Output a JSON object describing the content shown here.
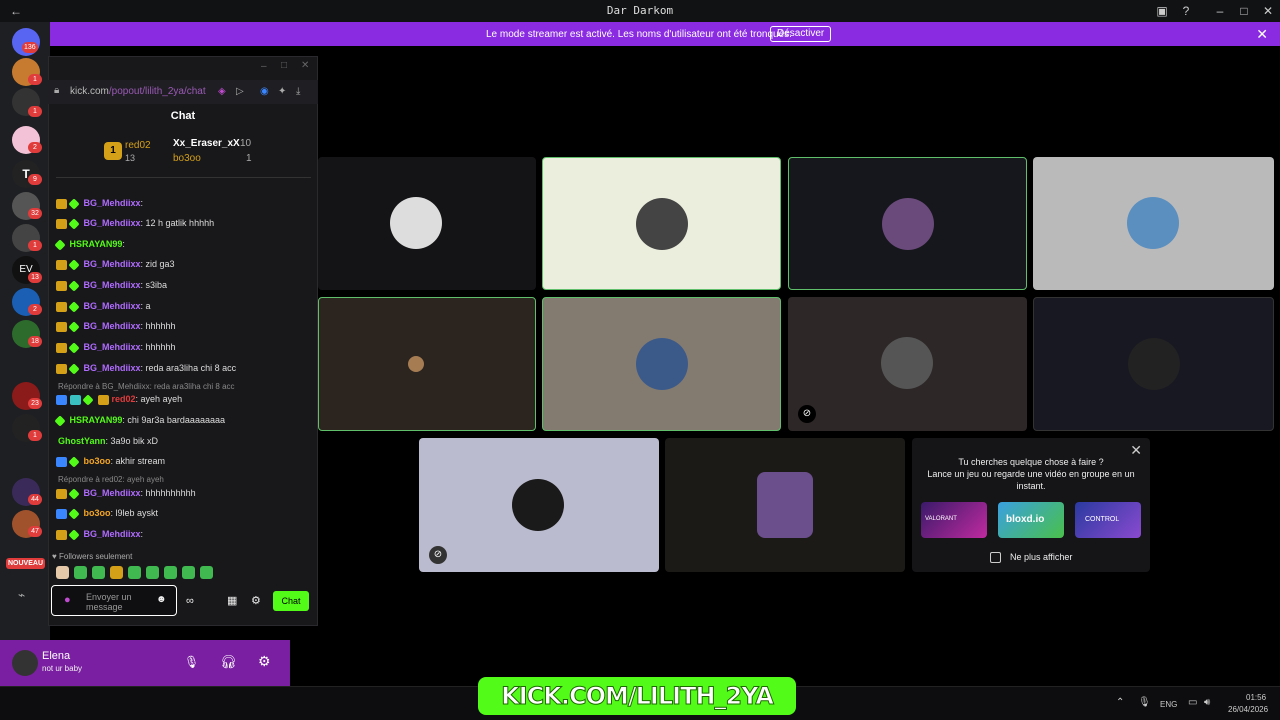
{
  "window": {
    "title": "Dar Darkom"
  },
  "banner": {
    "message": "Le mode streamer est activé. Les noms d'utilisateur ont été tronqués.",
    "button": "Désactiver"
  },
  "servers": [
    {
      "badge": "136"
    },
    {
      "badge": "1"
    },
    {
      "badge": "1"
    },
    {
      "badge": "2"
    },
    {
      "badge": "9"
    },
    {
      "badge": "32"
    },
    {
      "badge": "1"
    },
    {
      "badge": "13"
    },
    {
      "badge": "2"
    },
    {
      "badge": "18"
    },
    {
      "badge": "23"
    },
    {
      "badge": "1"
    },
    {
      "badge": "44"
    },
    {
      "badge": "47"
    }
  ],
  "new_label": "NOUVEAU",
  "chat": {
    "url_host": "kick.com",
    "url_path": "/popout/lilith_2ya/chat",
    "title": "Chat",
    "leaderboard": {
      "first": {
        "rank": "1",
        "name": "red02",
        "count": "13"
      },
      "second": {
        "name": "Xx_Eraser_xX",
        "count": "10"
      },
      "third": {
        "name": "bo3oo",
        "count": "1"
      }
    },
    "messages": [
      {
        "user": "BG_Mehdiixx",
        "text": ":",
        "color": "#b06bff"
      },
      {
        "user": "BG_Mehdiixx",
        "text": ": 12 h gatlik hhhhh",
        "color": "#b06bff"
      },
      {
        "user": "HSRAYAN99",
        "text": ":",
        "color": "#53fc18"
      },
      {
        "user": "BG_Mehdiixx",
        "text": ": zid ga3",
        "color": "#b06bff"
      },
      {
        "user": "BG_Mehdiixx",
        "text": ": s3iba",
        "color": "#b06bff"
      },
      {
        "user": "BG_Mehdiixx",
        "text": ": a",
        "color": "#b06bff"
      },
      {
        "user": "BG_Mehdiixx",
        "text": ": hhhhhh",
        "color": "#b06bff"
      },
      {
        "user": "BG_Mehdiixx",
        "text": ": hhhhhh",
        "color": "#b06bff"
      },
      {
        "user": "BG_Mehdiixx",
        "text": ": reda ara3liha chi 8 acc",
        "color": "#b06bff"
      },
      {
        "user": "red02",
        "text": ": ayeh ayeh",
        "color": "#e03c3c"
      },
      {
        "user": "HSRAYAN99",
        "text": ": chi 9ar3a bardaaaaaaaa",
        "color": "#53fc18"
      },
      {
        "user": "GhostYann",
        "text": ": 3a9o bik xD",
        "color": "#53fc18"
      },
      {
        "user": "bo3oo",
        "text": ": akhir stream",
        "color": "#f5a623"
      },
      {
        "user": "BG_Mehdiixx",
        "text": ": hhhhhhhhhh",
        "color": "#b06bff"
      },
      {
        "user": "bo3oo",
        "text": ": l9leb ayskt",
        "color": "#f5a623"
      },
      {
        "user": "BG_Mehdiixx",
        "text": ":",
        "color": "#b06bff"
      }
    ],
    "reply1": "Répondre à BG_Mehdiixx: reda ara3liha chi 8 acc",
    "reply2": "Répondre à red02: ayeh ayeh",
    "followers": "Followers seulement",
    "input_placeholder": "Envoyer un message",
    "send": "Chat"
  },
  "user": {
    "name": "Elena",
    "status": "not ur baby"
  },
  "promo": {
    "line1": "Tu cherches quelque chose à faire ?",
    "line2": "Lance un jeu ou regarde une vidéo en groupe en un instant.",
    "checkbox": "Ne plus afficher",
    "games": [
      "VALORANT",
      "bloxd.io",
      "CONTROL"
    ]
  },
  "stream": {
    "logo_text": "KICK.COM/LILITH_2YA"
  },
  "taskbar": {
    "lang": "ENG",
    "time": "01:56",
    "date": "26/04/2026"
  },
  "colors": {
    "accent": "#8a2be2",
    "kick": "#53fc18",
    "active_border": "#5fbf6a"
  }
}
